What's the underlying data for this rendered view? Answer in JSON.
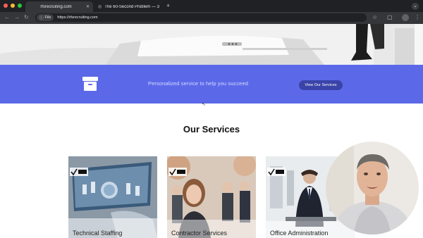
{
  "browser": {
    "tabs": [
      {
        "label": "rfsrecruiting.com",
        "active": true
      },
      {
        "label": "The 60-Second Problem — 3",
        "active": false
      }
    ],
    "file_chip": "File",
    "url": "https://rfsrecruiting.com"
  },
  "banner": {
    "tagline": "Personalized service to help you succeed",
    "button_label": "View Our Services"
  },
  "services": {
    "heading": "Our Services",
    "cards": [
      {
        "title": "Technical Staffing",
        "icon": "rfs-logo-icon"
      },
      {
        "title": "Contractor Services",
        "icon": "rfs-logo-icon"
      },
      {
        "title": "Office Administration",
        "icon": "rfs-logo-icon"
      }
    ]
  },
  "colors": {
    "banner": "#5b69e9",
    "button": "#3a43a8"
  }
}
